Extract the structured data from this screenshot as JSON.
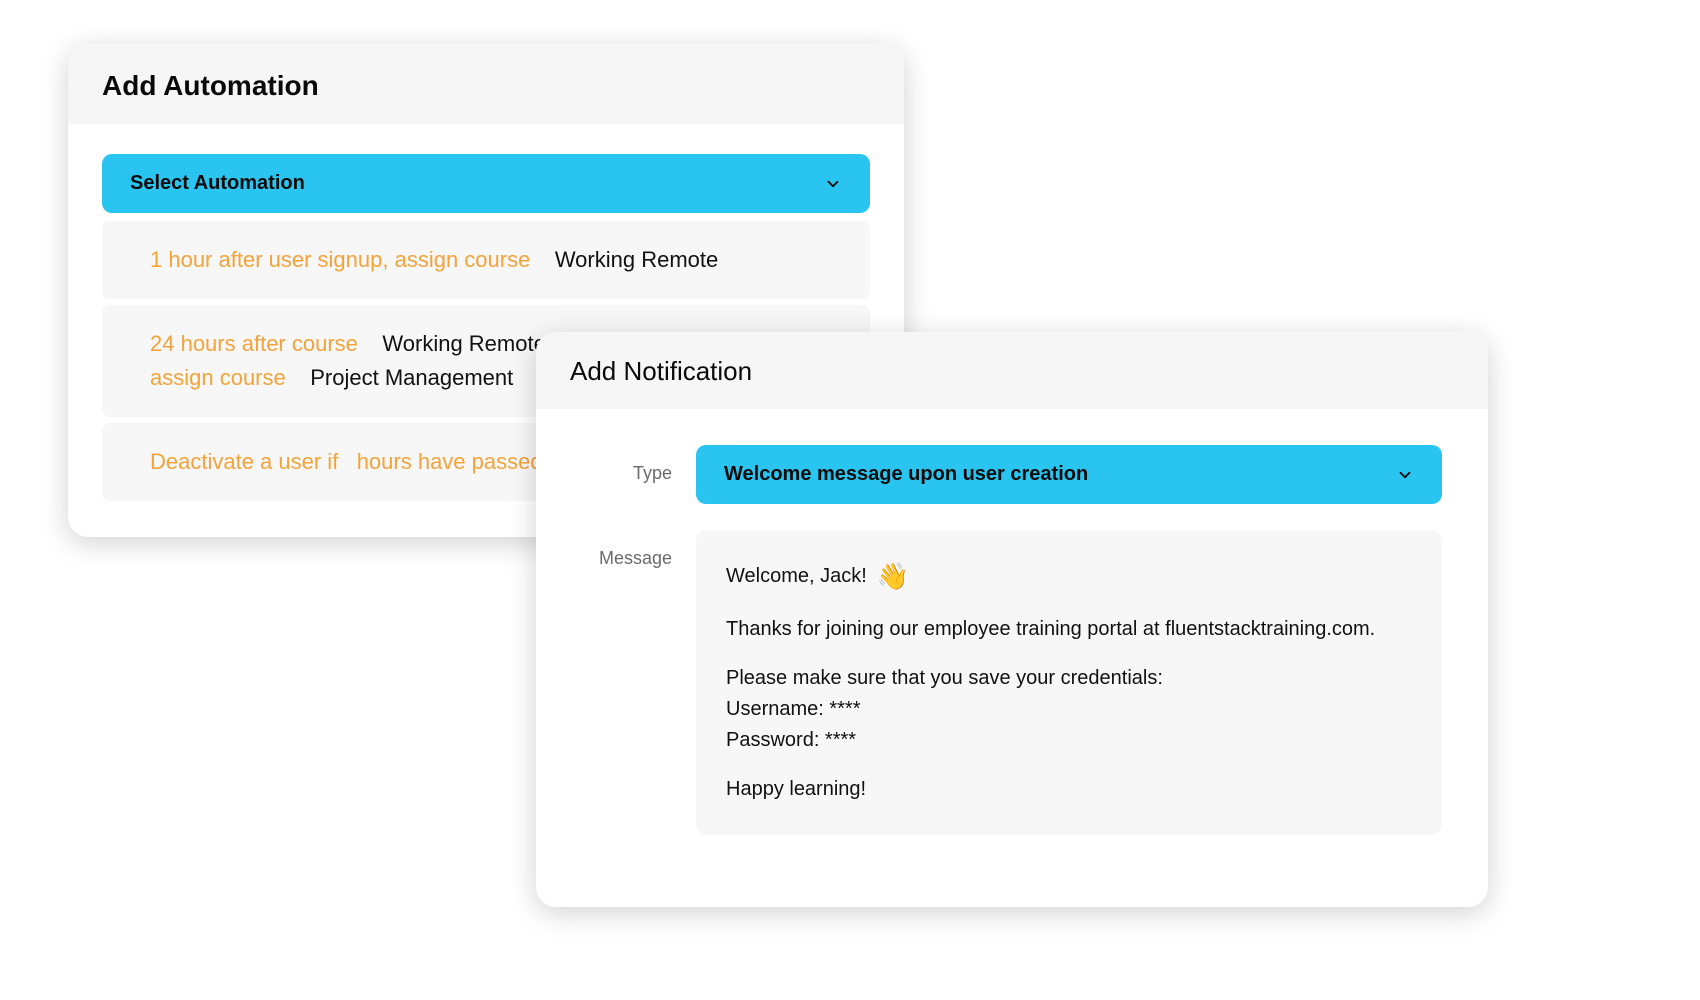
{
  "automation": {
    "title": "Add Automation",
    "select_label": "Select Automation",
    "rows": [
      {
        "prefix": "1 hour after user signup, assign course",
        "value": "Working Remote"
      },
      {
        "prefix": "24 hours after course",
        "value1": "Working Remote",
        "prefix2": "assign course",
        "value2": "Project Management"
      },
      {
        "prefix": "Deactivate a user if",
        "middle": "hours have passed"
      }
    ]
  },
  "notification": {
    "title": "Add Notification",
    "type_label": "Type",
    "type_value": "Welcome message upon user creation",
    "message_label": "Message",
    "message": {
      "greeting": "Welcome, Jack!",
      "wave": "👋",
      "thanks": "Thanks for joining our employee training portal at fluentstacktraining.com.",
      "creds_intro": "Please make sure that you save your credentials:",
      "username_line": "Username: ****",
      "password_line": "Password: ****",
      "closing": "Happy learning!"
    }
  },
  "colors": {
    "accent": "#29c4ef",
    "highlight_text": "#f3a33a"
  }
}
